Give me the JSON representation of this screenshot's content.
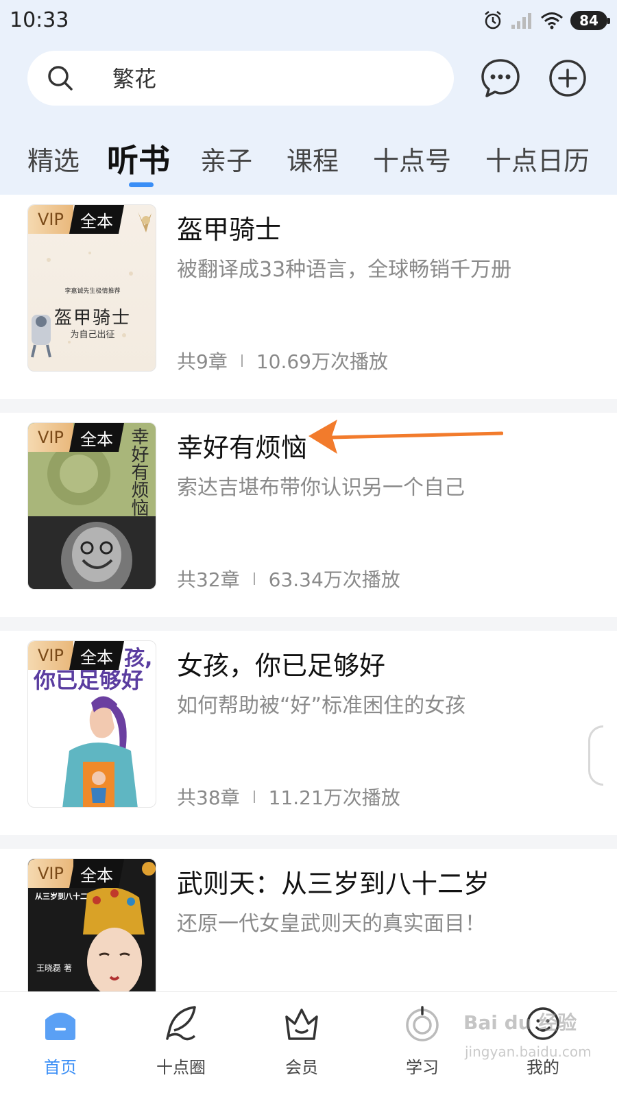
{
  "status_bar": {
    "time": "10:33",
    "battery": "84"
  },
  "search": {
    "query": "繁花"
  },
  "tabs": [
    "精选",
    "听书",
    "亲子",
    "课程",
    "十点号",
    "十点日历"
  ],
  "active_tab_index": 1,
  "books": [
    {
      "title": "盔甲骑士",
      "desc": "被翻译成33种语言，全球畅销千万册",
      "chapters": "共9章",
      "plays": "10.69万次播放",
      "badge_vip": "VIP",
      "badge_full": "全本",
      "cover_title": "盔甲骑士",
      "cover_subtitle": "为自己出征",
      "cover_tag": "李嘉诚先生极情推荐"
    },
    {
      "title": "幸好有烦恼",
      "desc": "索达吉堪布带你认识另一个自己",
      "chapters": "共32章",
      "plays": "63.34万次播放",
      "badge_vip": "VIP",
      "badge_full": "全本",
      "cover_title": "幸好有烦恼"
    },
    {
      "title": "女孩，你已足够好",
      "desc": "如何帮助被“好”标准困住的女孩",
      "chapters": "共38章",
      "plays": "11.21万次播放",
      "badge_vip": "VIP",
      "badge_full": "全本",
      "cover_title": "你已足够好",
      "cover_title_top": "孩,"
    },
    {
      "title": "武则天：从三岁到八十二岁",
      "desc": "还原一代女皇武则天的真实面目！",
      "chapters": "",
      "plays": "",
      "badge_vip": "VIP",
      "badge_full": "全本",
      "cover_title": "从三岁到八十二岁",
      "cover_author": "王晓磊 著"
    }
  ],
  "tabbar": [
    {
      "label": "首页",
      "icon": "home-icon"
    },
    {
      "label": "十点圈",
      "icon": "feather-icon"
    },
    {
      "label": "会员",
      "icon": "crown-icon"
    },
    {
      "label": "学习",
      "icon": "study-icon"
    },
    {
      "label": "我的",
      "icon": "profile-icon"
    }
  ],
  "active_tabbar_index": 0,
  "watermark": {
    "main": "Bai du 经验",
    "sub": "jingyan.baidu.com"
  },
  "colors": {
    "accent": "#3a8ef6",
    "arrow": "#f27b2c",
    "header_bg": "#eaf1fb"
  }
}
